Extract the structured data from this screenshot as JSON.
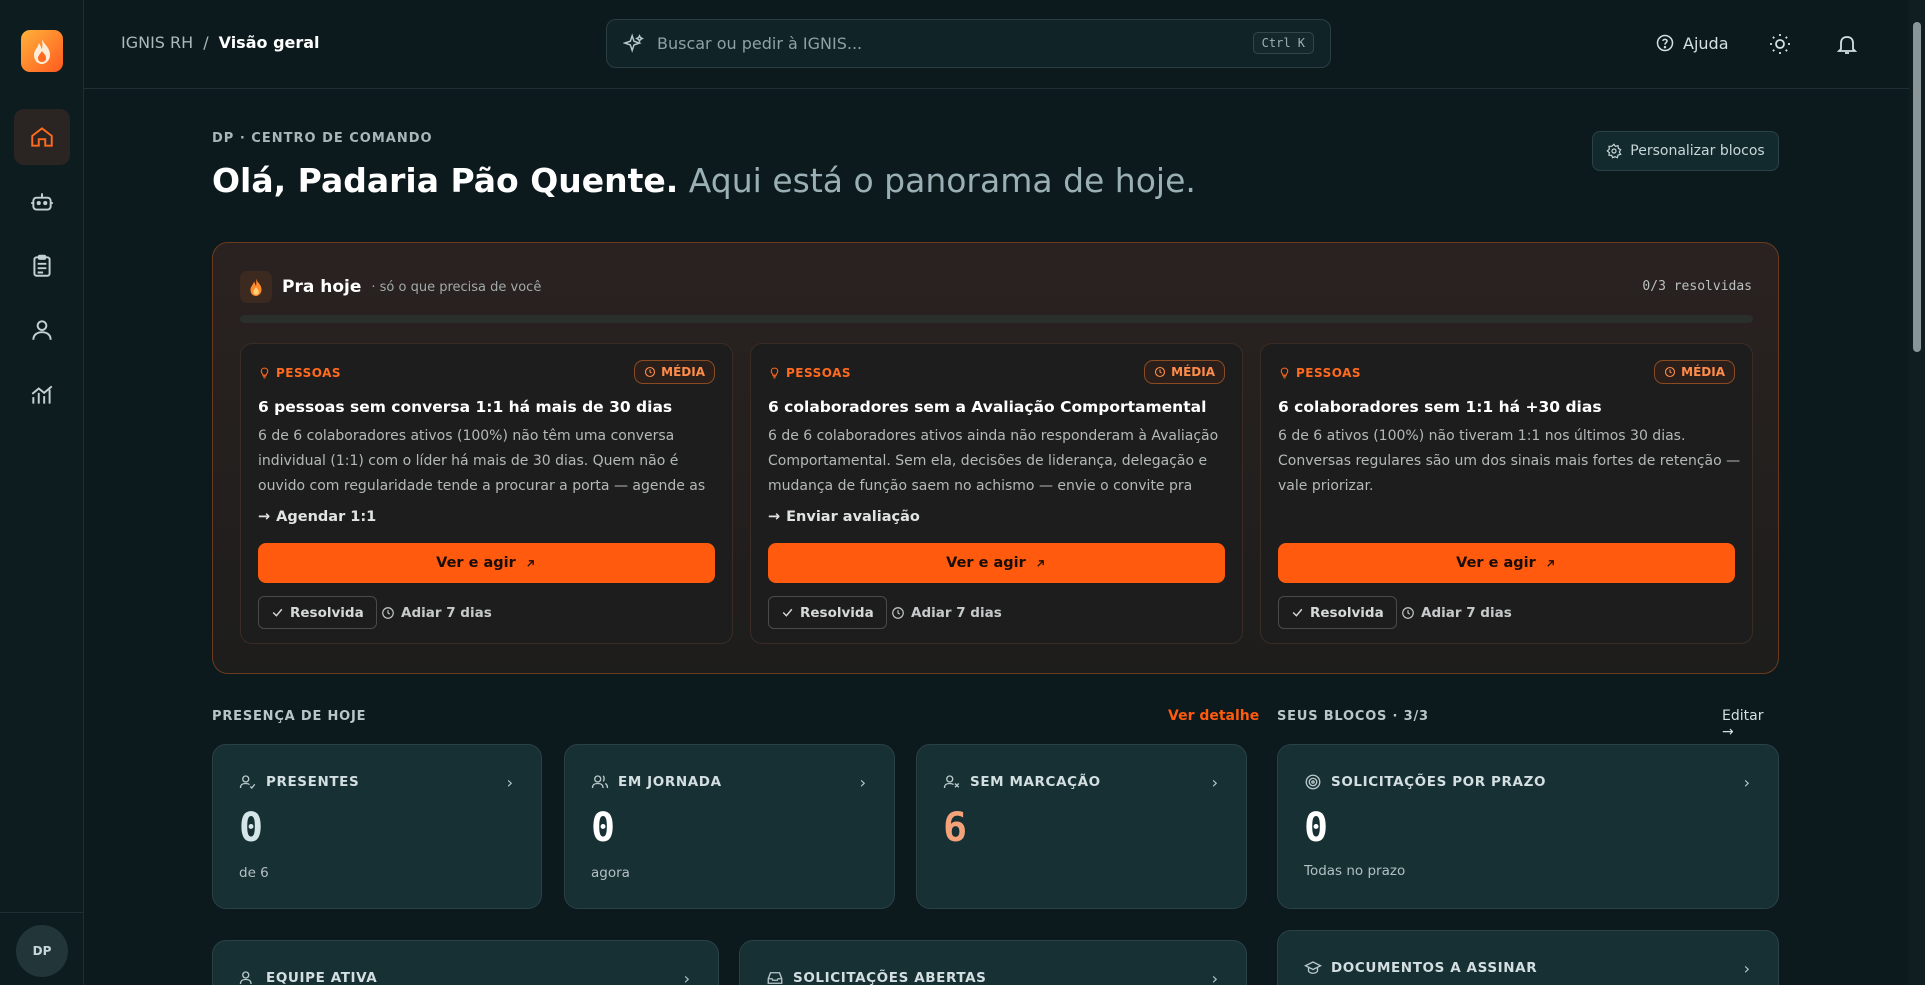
{
  "header": {
    "breadcrumb_root": "IGNIS RH",
    "breadcrumb_sep": "/",
    "breadcrumb_current": "Visão geral",
    "search_placeholder": "Buscar ou pedir à IGNIS...",
    "search_shortcut": "Ctrl K",
    "help_label": "Ajuda"
  },
  "sidebar": {
    "avatar_initials": "DP",
    "items": [
      "home-icon",
      "bot-icon",
      "clipboard-icon",
      "user-icon",
      "analytics-icon"
    ]
  },
  "main": {
    "eyebrow": "DP · CENTRO DE COMANDO",
    "greeting": "Olá, Padaria Pão Quente.",
    "greeting_sub": " Aqui está o panorama de hoje.",
    "customize_label": "Personalizar blocos"
  },
  "today": {
    "title": "Pra hoje",
    "subtitle": "· só o que precisa de você",
    "resolved": "0/3 resolvidas",
    "progress": 0,
    "cards": [
      {
        "category": "PESSOAS",
        "priority": "MÉDIA",
        "title": "6 pessoas sem conversa 1:1 há mais de 30 dias",
        "desc": "6 de 6 colaboradores ativos (100%) não têm uma conversa individual (1:1) com o líder há mais de 30 dias. Quem não é ouvido com regularidade tende a procurar a porta — agende as próximas...",
        "action": "Agendar 1:1",
        "cta": "Ver e agir",
        "resolve": "Resolvida",
        "postpone": "Adiar 7 dias"
      },
      {
        "category": "PESSOAS",
        "priority": "MÉDIA",
        "title": "6 colaboradores sem a Avaliação Comportamental",
        "desc": "6 de 6 colaboradores ativos ainda não responderam à Avaliação Comportamental. Sem ela, decisões de liderança, delegação e mudança de função saem no achismo — envie o convite pra quem...",
        "action": "Enviar avaliação",
        "cta": "Ver e agir",
        "resolve": "Resolvida",
        "postpone": "Adiar 7 dias"
      },
      {
        "category": "PESSOAS",
        "priority": "MÉDIA",
        "title": "6 colaboradores sem 1:1 há +30 dias",
        "desc": "6 de 6 ativos (100%) não tiveram 1:1 nos últimos 30 dias. Conversas regulares são um dos sinais mais fortes de retenção — vale priorizar.",
        "action": "",
        "cta": "Ver e agir",
        "resolve": "Resolvida",
        "postpone": "Adiar 7 dias"
      }
    ]
  },
  "presence": {
    "label": "PRESENÇA DE HOJE",
    "link": "Ver detalhe",
    "tiles": [
      {
        "label": "PRESENTES",
        "value": "0",
        "sub": "de 6"
      },
      {
        "label": "EM JORNADA",
        "value": "0",
        "sub": "agora"
      },
      {
        "label": "SEM MARCAÇÃO",
        "value": "6",
        "sub": ""
      }
    ],
    "lower_tiles": [
      {
        "label": "EQUIPE ATIVA"
      },
      {
        "label": "SOLICITAÇÕES ABERTAS"
      }
    ]
  },
  "blocks": {
    "label": "SEUS BLOCOS · 3/3",
    "link": "Editar →",
    "tiles": [
      {
        "label": "SOLICITAÇÕES POR PRAZO",
        "value": "0",
        "sub": "Todas no prazo"
      },
      {
        "label": "DOCUMENTOS A ASSINAR"
      }
    ]
  },
  "colors": {
    "accent": "#ff5a0d",
    "warning_value": "#f3a27a",
    "background": "#0c1a1d",
    "tile": "#173034"
  }
}
